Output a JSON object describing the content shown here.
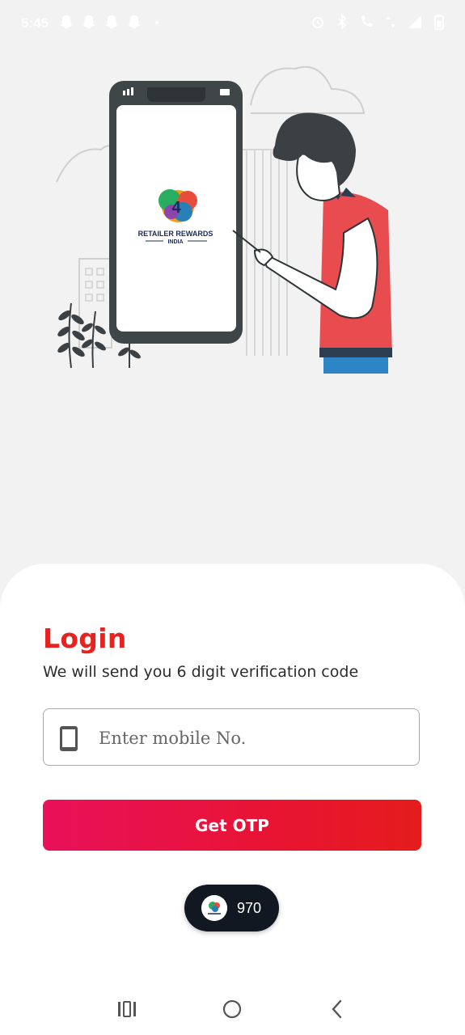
{
  "status_bar": {
    "time": "5:45",
    "left_icons": [
      "snapchat-icon",
      "snapchat-icon",
      "snapchat-icon",
      "snapchat-icon",
      "dot-icon"
    ],
    "right_icons": [
      "alarm-icon",
      "bluetooth-icon",
      "wifi-calling-icon",
      "data-arrows-icon",
      "signal-icon",
      "battery-icon"
    ]
  },
  "illustration": {
    "logo_line1": "RETAILER REWARDS",
    "logo_line2": "INDIA"
  },
  "login": {
    "title": "Login",
    "subtitle": "We will send you 6 digit verification code",
    "mobile_placeholder": "Enter mobile No.",
    "mobile_value": "",
    "button_label": "Get OTP"
  },
  "toast": {
    "count": "970"
  },
  "nav_bar": {
    "buttons": [
      "recent-apps-icon",
      "home-icon",
      "back-icon"
    ]
  },
  "colors": {
    "accent_red": "#e8231f",
    "button_gradient_start": "#e8115a",
    "button_gradient_end": "#e41c1c",
    "background": "#f2f2f2",
    "card": "#ffffff"
  }
}
